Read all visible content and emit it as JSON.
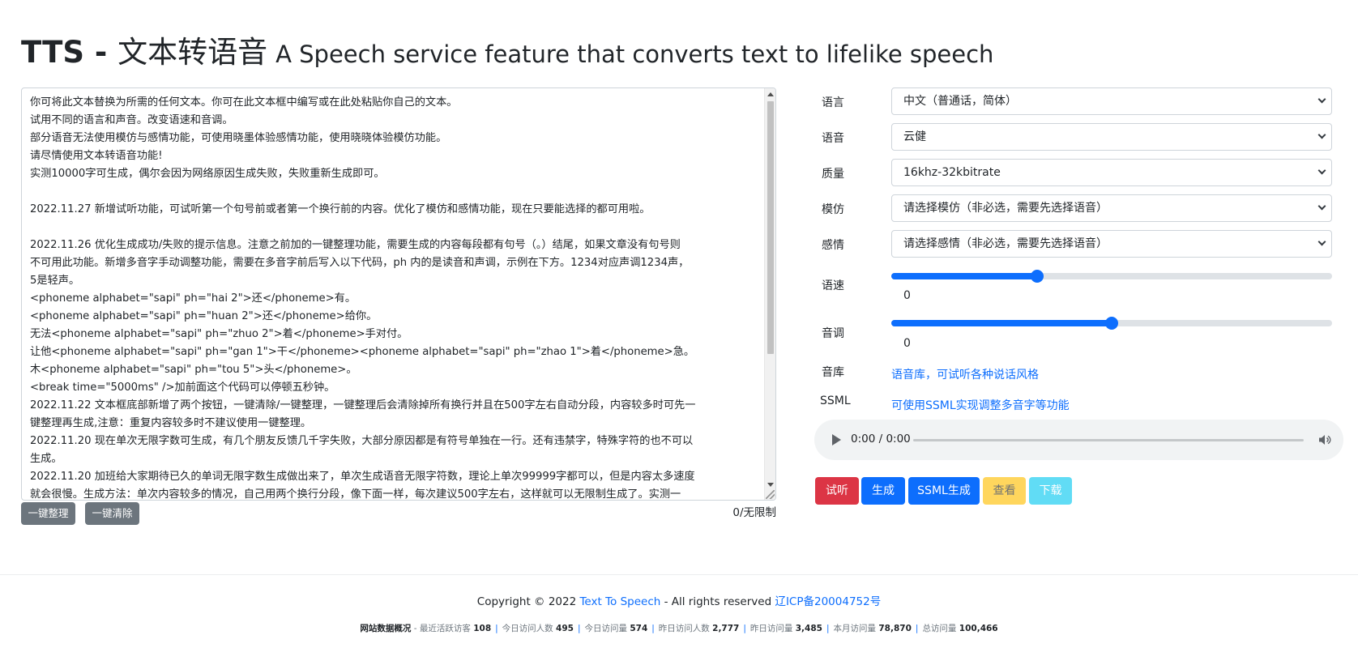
{
  "header": {
    "title_prefix": "TTS - ",
    "title_cn": "文本转语音",
    "subtitle": "A Speech service feature that converts text to lifelike speech"
  },
  "editor": {
    "lines": [
      "你可将此文本替换为所需的任何文本。你可在此文本框中编写或在此处粘贴你自己的文本。",
      "试用不同的语言和声音。改变语速和音调。",
      "部分语音无法使用模仿与感情功能，可使用晓墨体验感情功能，使用晓晓体验模仿功能。",
      "请尽情使用文本转语音功能!",
      "实测10000字可生成，偶尔会因为网络原因生成失败，失败重新生成即可。",
      "",
      "2022.11.27 新增试听功能，可试听第一个句号前或者第一个换行前的内容。优化了模仿和感情功能，现在只要能选择的都可用啦。",
      "",
      "2022.11.26 优化生成成功/失败的提示信息。注意之前加的一键整理功能，需要生成的内容每段都有句号（。）结尾，如果文章没有句号则",
      "不可用此功能。新增多音字手动调整功能，需要在多音字前后写入以下代码，ph 内的是读音和声调，示例在下方。1234对应声调1234声，",
      "5是轻声。",
      "<phoneme alphabet=\"sapi\" ph=\"hai 2\">还</phoneme>有。",
      "<phoneme alphabet=\"sapi\" ph=\"huan 2\">还</phoneme>给你。",
      "无法<phoneme alphabet=\"sapi\" ph=\"zhuo 2\">着</phoneme>手对付。",
      "让他<phoneme alphabet=\"sapi\" ph=\"gan 1\">干</phoneme><phoneme alphabet=\"sapi\" ph=\"zhao 1\">着</phoneme>急。",
      "木<phoneme alphabet=\"sapi\" ph=\"tou 5\">头</phoneme>。",
      "<break time=\"5000ms\" />加前面这个代码可以停顿五秒钟。",
      "2022.11.22 文本框底部新增了两个按钮，一键清除/一键整理，一键整理后会清除掉所有换行并且在500字左右自动分段，内容较多时可先一",
      "键整理再生成,注意：重复内容较多时不建议使用一键整理。",
      "2022.11.20 现在单次无限字数可生成，有几个朋友反馈几千字失败，大部分原因都是有符号单独在一行。还有违禁字，特殊字符的也不可以",
      "生成。",
      "2022.11.20 加班给大家期待已久的单词无限字数生成做出来了，单次生成语音无限字符数，理论上单次99999字都可以，但是内容太多速度",
      "就会很慢。生成方法：单次内容较多的情况，自己用两个换行分段，像下面一样，每次建议500字左右，这样就可以无限制生成了。实测一"
    ],
    "tidy_button": "一键整理",
    "clear_button": "一键清除",
    "char_count": "0/无限制"
  },
  "form": {
    "language": {
      "label": "语言",
      "value": "中文（普通话，简体）"
    },
    "voice": {
      "label": "语音",
      "value": "云健"
    },
    "quality": {
      "label": "质量",
      "value": "16khz-32kbitrate"
    },
    "imitation": {
      "label": "模仿",
      "value": "请选择模仿（非必选，需要先选择语音）"
    },
    "emotion": {
      "label": "感情",
      "value": "请选择感情（非必选，需要先选择语音）"
    },
    "rate": {
      "label": "语速",
      "value": "0",
      "position_fraction": 0.33
    },
    "pitch": {
      "label": "音调",
      "value": "0",
      "position_fraction": 0.5
    },
    "voice_library": {
      "label": "音库",
      "link_text": "语音库，可试听各种说话风格"
    },
    "ssml": {
      "label": "SSML",
      "link_text": "可使用SSML实现调整多音字等功能"
    }
  },
  "audio": {
    "time": "0:00 / 0:00"
  },
  "actions": {
    "preview": {
      "label": "试听",
      "color": "#dc3545"
    },
    "generate": {
      "label": "生成",
      "color": "#0d6efd"
    },
    "ssml_generate": {
      "label": "SSML生成",
      "color": "#0d6efd"
    },
    "view": {
      "label": "查看",
      "color": "#ffc107"
    },
    "download": {
      "label": "下载",
      "color": "#0dcaf0"
    }
  },
  "footer": {
    "copyright_prefix": "Copyright © 2022 ",
    "site_name": "Text To Speech",
    "rights": " - All rights reserved ",
    "icp": "辽ICP备20004752号"
  },
  "stats": {
    "title": "网站数据概况",
    "items": [
      {
        "label": "最近活跃访客",
        "value": "108"
      },
      {
        "label": "今日访问人数",
        "value": "495"
      },
      {
        "label": "今日访问量",
        "value": "574"
      },
      {
        "label": "昨日访问人数",
        "value": "2,777"
      },
      {
        "label": "昨日访问量",
        "value": "3,485"
      },
      {
        "label": "本月访问量",
        "value": "78,870"
      },
      {
        "label": "总访问量",
        "value": "100,466"
      }
    ]
  }
}
